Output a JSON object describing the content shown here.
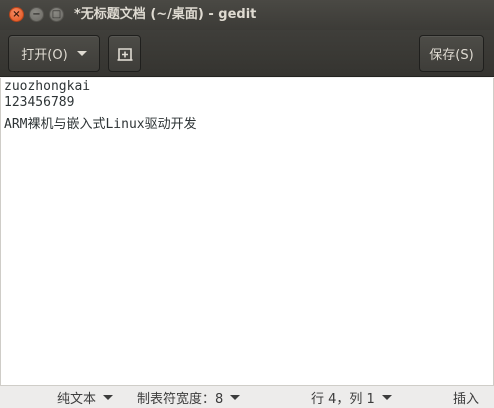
{
  "window": {
    "title": "*无标题文档 (~/桌面) - gedit",
    "close_glyph": "×",
    "min_glyph": "−",
    "max_glyph": "□"
  },
  "toolbar": {
    "open_label": "打开(O)",
    "new_tab_glyph": "+",
    "save_label": "保存(S)"
  },
  "editor": {
    "lines": [
      "zuozhongkai",
      "123456789",
      "ARM裸机与嵌入式Linux驱动开发"
    ]
  },
  "statusbar": {
    "language": "纯文本",
    "tab_width": "制表符宽度：8",
    "cursor_position": "行 4，列 1",
    "insert_mode": "插入"
  }
}
